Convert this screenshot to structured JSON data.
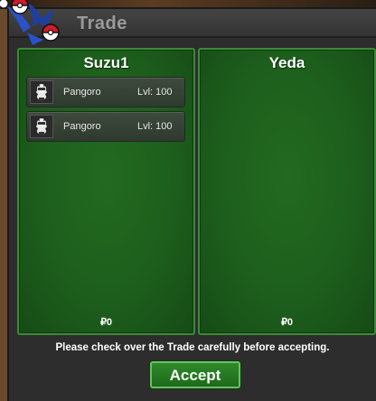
{
  "window": {
    "title": "Trade"
  },
  "panels": [
    {
      "name": "Suzu1",
      "items": [
        {
          "pokemon": "Pangoro",
          "level": "Lvl: 100"
        },
        {
          "pokemon": "Pangoro",
          "level": "Lvl: 100"
        }
      ],
      "money": "₽0"
    },
    {
      "name": "Yeda",
      "items": [],
      "money": "₽0"
    }
  ],
  "footer": {
    "notice": "Please check over the Trade carefully before accepting.",
    "accept_label": "Accept"
  },
  "colors": {
    "panel_green": "#1d5e1c",
    "panel_border": "#3c8a38",
    "accept_green": "#2f8a2b",
    "title_gray": "#9a9a9a"
  },
  "icons": [
    "pokeball-logo-icon",
    "pangoro-sprite-icon"
  ]
}
